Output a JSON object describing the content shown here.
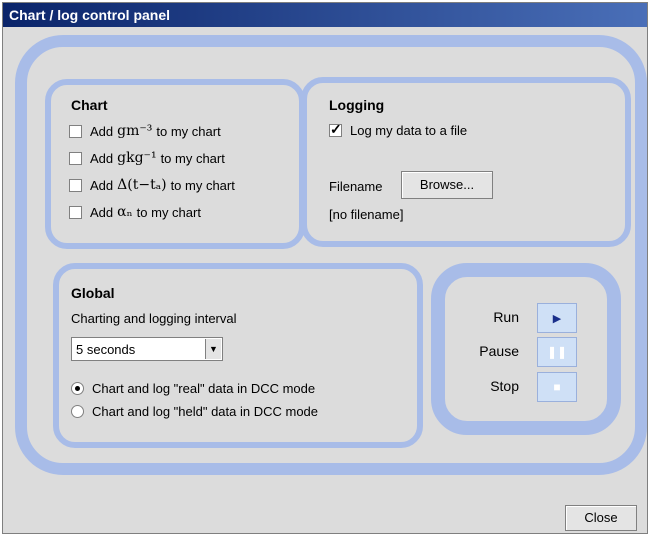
{
  "window": {
    "title": "Chart / log control panel"
  },
  "chart": {
    "title": "Chart",
    "items": [
      {
        "pre": "Add",
        "formula": "gm⁻³",
        "post": "to my chart",
        "checked": false
      },
      {
        "pre": "Add",
        "formula": "gkg⁻¹",
        "post": "to my chart",
        "checked": false
      },
      {
        "pre": "Add",
        "formula": "Δ(t−tₐ)",
        "post": "to my chart",
        "checked": false
      },
      {
        "pre": "Add",
        "formula": "αₙ",
        "post": "to my chart",
        "checked": false
      }
    ]
  },
  "logging": {
    "title": "Logging",
    "log_label": "Log my data to a file",
    "log_checked": true,
    "filename_label": "Filename",
    "browse_label": "Browse...",
    "filename_value": "[no filename]"
  },
  "global": {
    "title": "Global",
    "interval_label": "Charting and logging interval",
    "interval_value": "5 seconds",
    "radio_options": [
      {
        "label": "Chart and log \"real\" data in DCC mode",
        "selected": true
      },
      {
        "label": "Chart and log \"held\" data in DCC mode",
        "selected": false
      }
    ]
  },
  "controls": {
    "run_label": "Run",
    "pause_label": "Pause",
    "stop_label": "Stop"
  },
  "footer": {
    "close_label": "Close"
  }
}
